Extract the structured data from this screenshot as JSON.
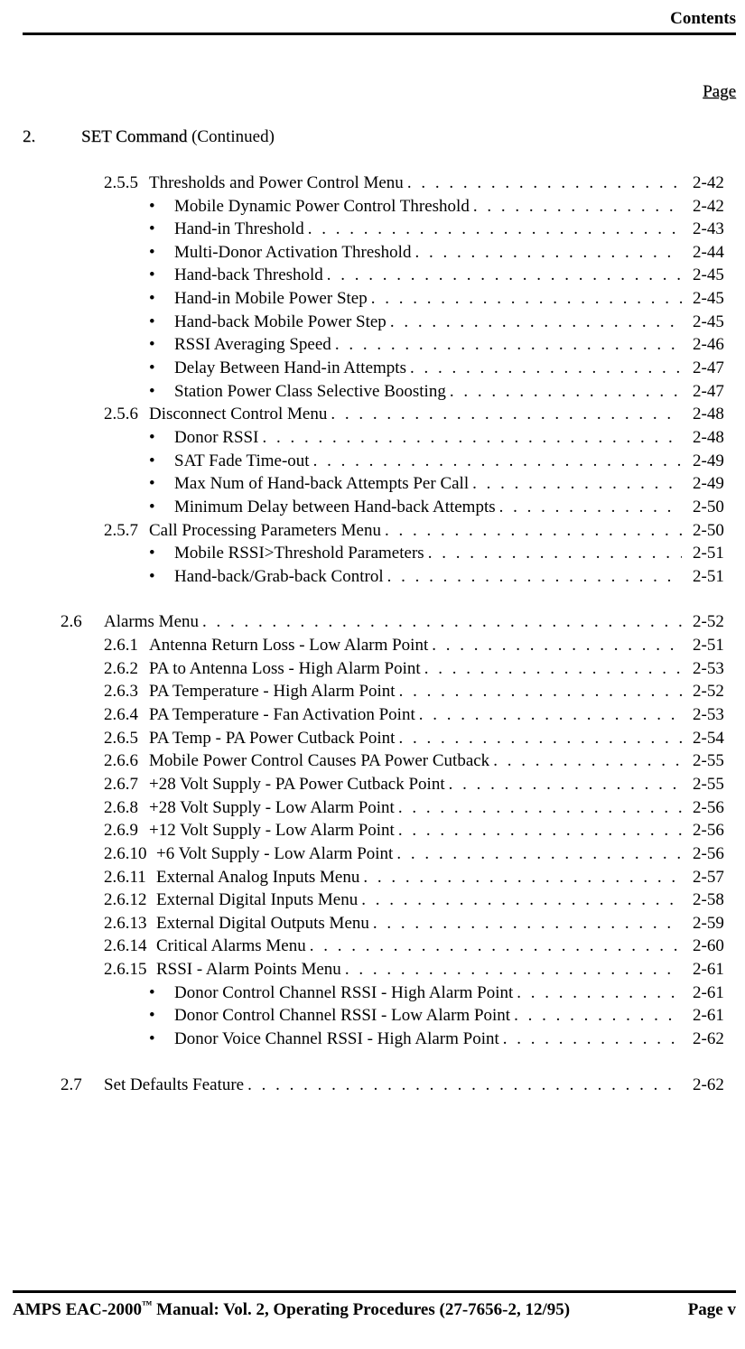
{
  "header": {
    "contents": "Contents",
    "page_label": "Page"
  },
  "section": {
    "num": "2.",
    "title": "SET Command",
    "cont": "(Continued)"
  },
  "toc": {
    "g1": {
      "h1": {
        "num": "2.5.5",
        "title": "Thresholds and Power Control Menu",
        "pg": "2-42"
      },
      "b1": {
        "title": "Mobile Dynamic Power Control Threshold",
        "pg": "2-42"
      },
      "b2": {
        "title": "Hand-in Threshold",
        "pg": "2-43"
      },
      "b3": {
        "title": "Multi-Donor Activation Threshold",
        "pg": "2-44"
      },
      "b4": {
        "title": "Hand-back Threshold",
        "pg": "2-45"
      },
      "b5": {
        "title": "Hand-in Mobile Power Step",
        "pg": "2-45"
      },
      "b6": {
        "title": "Hand-back Mobile Power Step",
        "pg": "2-45"
      },
      "b7": {
        "title": "RSSI Averaging Speed",
        "pg": "2-46"
      },
      "b8": {
        "title": "Delay Between Hand-in Attempts",
        "pg": "2-47"
      },
      "b9": {
        "title": "Station Power Class Selective Boosting",
        "pg": "2-47"
      },
      "h2": {
        "num": "2.5.6",
        "title": "Disconnect Control Menu",
        "pg": "2-48"
      },
      "b10": {
        "title": "Donor RSSI",
        "pg": "2-48"
      },
      "b11": {
        "title": "SAT Fade Time-out",
        "pg": "2-49"
      },
      "b12": {
        "title": "Max Num of Hand-back Attempts Per Call",
        "pg": "2-49"
      },
      "b13": {
        "title": "Minimum Delay between Hand-back Attempts",
        "pg": "2-50"
      },
      "h3": {
        "num": "2.5.7",
        "title": "Call Processing Parameters Menu",
        "pg": "2-50"
      },
      "b14": {
        "title": "Mobile RSSI>Threshold Parameters",
        "pg": "2-51"
      },
      "b15": {
        "title": "Hand-back/Grab-back Control",
        "pg": "2-51"
      }
    },
    "g2": {
      "h": {
        "num": "2.6",
        "title": "Alarms Menu",
        "pg": "2-52"
      },
      "i1": {
        "num": "2.6.1",
        "title": "Antenna Return Loss - Low Alarm Point",
        "pg": "2-51"
      },
      "i2": {
        "num": "2.6.2",
        "title": "PA to Antenna Loss - High Alarm Point",
        "pg": "2-53"
      },
      "i3": {
        "num": "2.6.3",
        "title": "PA Temperature - High Alarm Point",
        "pg": "2-52"
      },
      "i4": {
        "num": "2.6.4",
        "title": "PA Temperature - Fan Activation Point",
        "pg": "2-53"
      },
      "i5": {
        "num": "2.6.5",
        "title": "PA Temp - PA Power Cutback Point",
        "pg": "2-54"
      },
      "i6": {
        "num": "2.6.6",
        "title": "Mobile Power Control Causes PA Power Cutback",
        "pg": "2-55"
      },
      "i7": {
        "num": "2.6.7",
        "title": "+28 Volt Supply - PA Power Cutback Point",
        "pg": "2-55"
      },
      "i8": {
        "num": "2.6.8",
        "title": "+28 Volt Supply - Low Alarm Point",
        "pg": "2-56"
      },
      "i9": {
        "num": "2.6.9",
        "title": "+12 Volt Supply - Low Alarm Point",
        "pg": "2-56"
      },
      "i10": {
        "num": "2.6.10",
        "title": "+6 Volt Supply - Low Alarm Point",
        "pg": "2-56"
      },
      "i11": {
        "num": "2.6.11",
        "title": "External Analog Inputs Menu",
        "pg": "2-57"
      },
      "i12": {
        "num": "2.6.12",
        "title": "External Digital Inputs Menu",
        "pg": "2-58"
      },
      "i13": {
        "num": "2.6.13",
        "title": "External Digital Outputs Menu",
        "pg": "2-59"
      },
      "i14": {
        "num": "2.6.14",
        "title": "Critical Alarms Menu",
        "pg": "2-60"
      },
      "i15": {
        "num": "2.6.15",
        "title": "RSSI - Alarm Points Menu",
        "pg": "2-61"
      },
      "b1": {
        "title": "Donor Control Channel RSSI - High Alarm Point",
        "pg": "2-61"
      },
      "b2": {
        "title": "Donor Control Channel RSSI - Low Alarm Point",
        "pg": "2-61"
      },
      "b3": {
        "title": "Donor Voice Channel RSSI - High Alarm Point",
        "pg": "2-62"
      }
    },
    "g3": {
      "h": {
        "num": "2.7",
        "title": "Set Defaults Feature",
        "pg": "2-62"
      }
    }
  },
  "footer": {
    "left_a": "AMPS EAC-2000",
    "left_b": " Manual:  Vol. 2, Operating Procedures (27-7656-2, 12/95)",
    "right": "Page v"
  }
}
